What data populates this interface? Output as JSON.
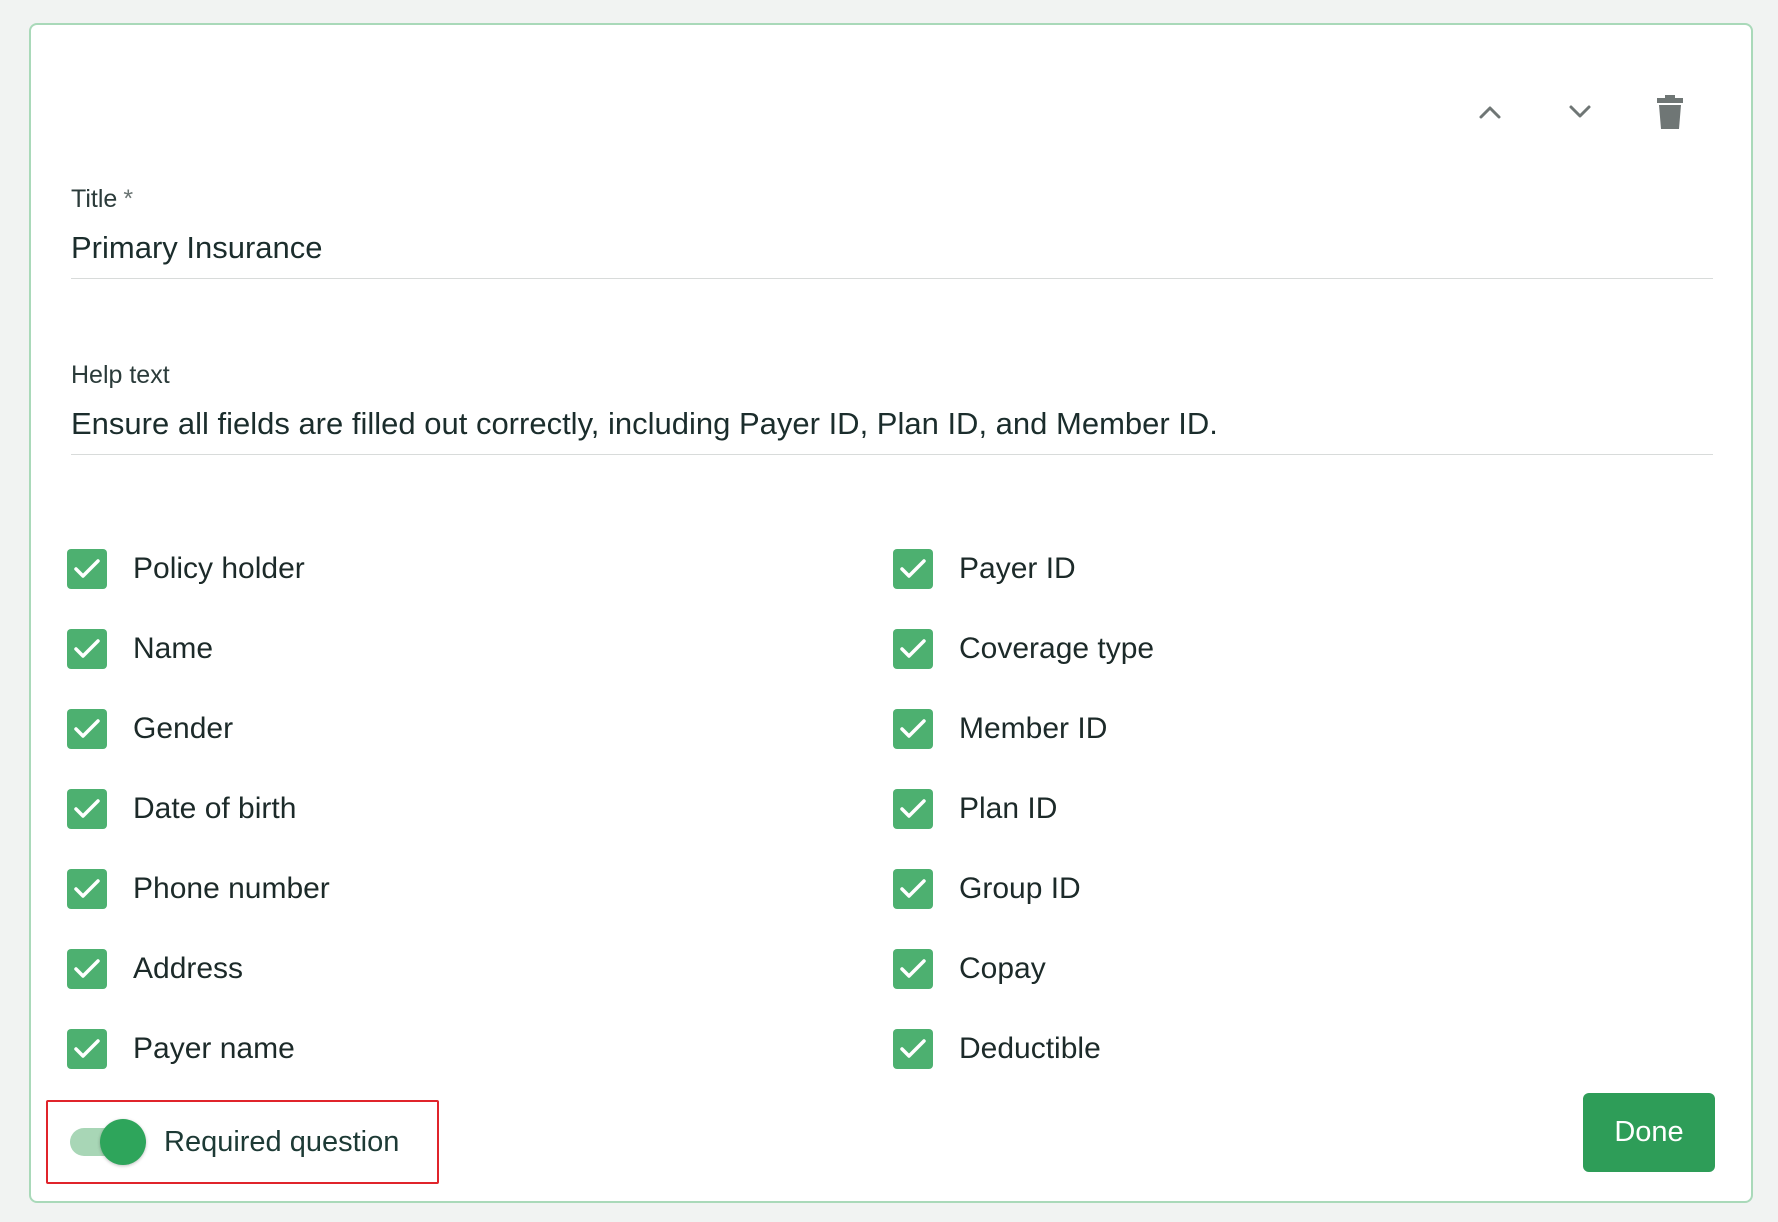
{
  "toolbar": {
    "move_up_icon": "chevron-up-icon",
    "move_down_icon": "chevron-down-icon",
    "delete_icon": "trash-icon"
  },
  "title_field": {
    "label": "Title",
    "required_marker": "*",
    "value": "Primary Insurance"
  },
  "help_field": {
    "label": "Help text",
    "value": "Ensure all fields are filled out correctly, including Payer ID, Plan ID, and Member ID."
  },
  "options": {
    "left": [
      {
        "label": "Policy holder",
        "checked": true
      },
      {
        "label": "Name",
        "checked": true
      },
      {
        "label": "Gender",
        "checked": true
      },
      {
        "label": "Date of birth",
        "checked": true
      },
      {
        "label": "Phone number",
        "checked": true
      },
      {
        "label": "Address",
        "checked": true
      },
      {
        "label": "Payer name",
        "checked": true
      }
    ],
    "right": [
      {
        "label": "Payer ID",
        "checked": true
      },
      {
        "label": "Coverage type",
        "checked": true
      },
      {
        "label": "Member ID",
        "checked": true
      },
      {
        "label": "Plan ID",
        "checked": true
      },
      {
        "label": "Group ID",
        "checked": true
      },
      {
        "label": "Copay",
        "checked": true
      },
      {
        "label": "Deductible",
        "checked": true
      }
    ]
  },
  "required_toggle": {
    "label": "Required question",
    "on": true
  },
  "done_button": {
    "label": "Done"
  },
  "colors": {
    "accent": "#2e9d58",
    "checkbox": "#4db070",
    "highlight_border": "#e0242b"
  }
}
